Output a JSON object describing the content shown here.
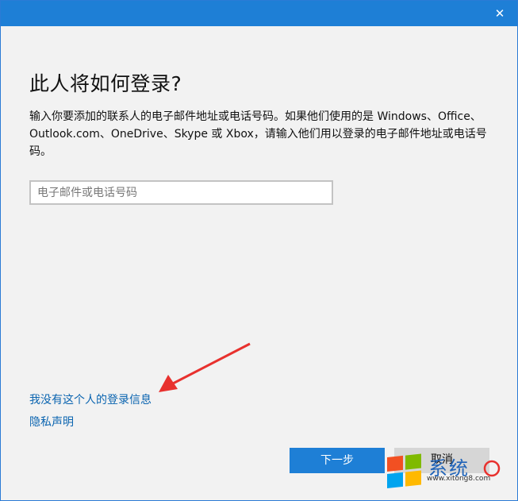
{
  "window": {
    "close_glyph": "✕"
  },
  "heading": "此人将如何登录?",
  "description": "输入你要添加的联系人的电子邮件地址或电话号码。如果他们使用的是 Windows、Office、Outlook.com、OneDrive、Skype 或 Xbox，请输入他们用以登录的电子邮件地址或电话号码。",
  "email_input": {
    "placeholder": "电子邮件或电话号码",
    "value": ""
  },
  "links": {
    "no_info": "我没有这个人的登录信息",
    "privacy": "隐私声明"
  },
  "buttons": {
    "next": "下一步",
    "cancel": "取消"
  },
  "watermark": {
    "text": "系统",
    "url": "www.xitong8.com"
  },
  "colors": {
    "accent": "#1e7fd6",
    "link": "#0a64b0",
    "arrow": "#e8312e"
  }
}
